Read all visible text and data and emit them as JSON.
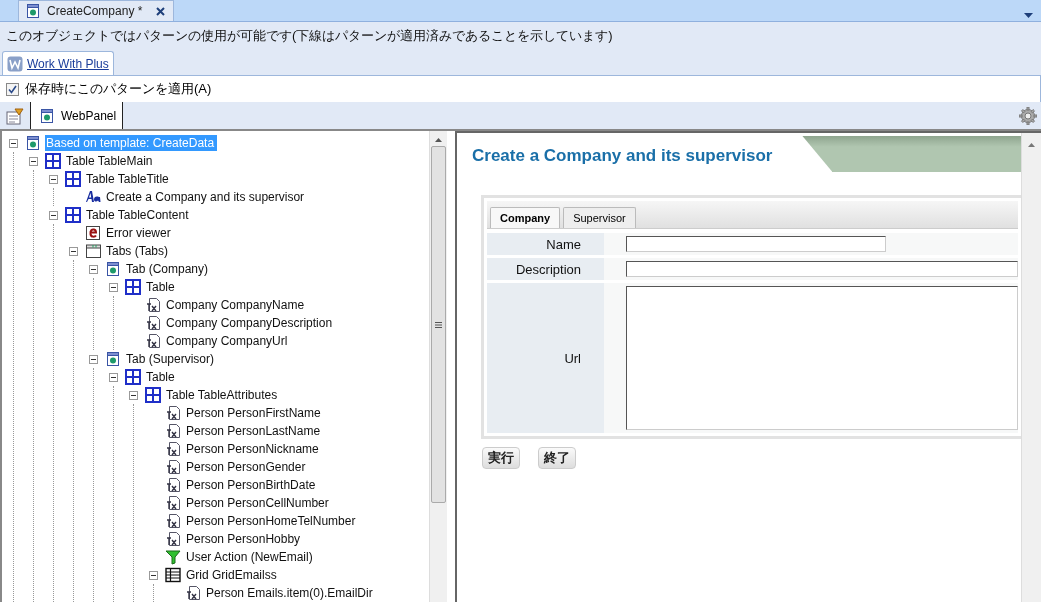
{
  "document_tab": {
    "title": "CreateCompany *",
    "selected": true
  },
  "info_text": "このオブジェクトではパターンの使用が可能です(下線はパターンが適用済みであることを示しています)",
  "pattern_tab": {
    "label": "Work With Plus",
    "selected": true
  },
  "apply_on_save": {
    "label": "保存時にこのパターンを適用(A)",
    "checked": true
  },
  "toolbar": {
    "tabs": [
      {
        "label": "WebPanel",
        "selected": true
      }
    ]
  },
  "tree": [
    {
      "label": "Based on template: CreateData",
      "kind": "form",
      "selected": true,
      "expanded": true,
      "children": [
        {
          "label": "Table TableMain",
          "kind": "table",
          "selected": false,
          "expanded": true,
          "children": [
            {
              "label": "Table TableTitle",
              "kind": "table",
              "selected": false,
              "expanded": true,
              "children": [
                {
                  "label": "Create a Company and its supervisor",
                  "kind": "text",
                  "selected": false
                }
              ]
            },
            {
              "label": "Table TableContent",
              "kind": "table",
              "selected": false,
              "expanded": true,
              "children": [
                {
                  "label": "Error viewer",
                  "kind": "error",
                  "selected": false
                },
                {
                  "label": "Tabs (Tabs)",
                  "kind": "tabs",
                  "selected": false,
                  "expanded": true,
                  "children": [
                    {
                      "label": "Tab (Company)",
                      "kind": "form",
                      "selected": false,
                      "expanded": true,
                      "children": [
                        {
                          "label": "Table",
                          "kind": "table",
                          "selected": false,
                          "expanded": true,
                          "children": [
                            {
                              "label": "Company CompanyName",
                              "kind": "attribute",
                              "selected": false
                            },
                            {
                              "label": "Company CompanyDescription",
                              "kind": "attribute",
                              "selected": false
                            },
                            {
                              "label": "Company CompanyUrl",
                              "kind": "attribute",
                              "selected": false
                            }
                          ]
                        }
                      ]
                    },
                    {
                      "label": "Tab (Supervisor)",
                      "kind": "form",
                      "selected": false,
                      "expanded": true,
                      "children": [
                        {
                          "label": "Table",
                          "kind": "table",
                          "selected": false,
                          "expanded": true,
                          "children": [
                            {
                              "label": "Table TableAttributes",
                              "kind": "table",
                              "selected": false,
                              "expanded": true,
                              "children": [
                                {
                                  "label": "Person PersonFirstName",
                                  "kind": "attribute",
                                  "selected": false
                                },
                                {
                                  "label": "Person PersonLastName",
                                  "kind": "attribute",
                                  "selected": false
                                },
                                {
                                  "label": "Person PersonNickname",
                                  "kind": "attribute",
                                  "selected": false
                                },
                                {
                                  "label": "Person PersonGender",
                                  "kind": "attribute",
                                  "selected": false
                                },
                                {
                                  "label": "Person PersonBirthDate",
                                  "kind": "attribute",
                                  "selected": false
                                },
                                {
                                  "label": "Person PersonCellNumber",
                                  "kind": "attribute",
                                  "selected": false
                                },
                                {
                                  "label": "Person PersonHomeTelNumber",
                                  "kind": "attribute",
                                  "selected": false
                                },
                                {
                                  "label": "Person PersonHobby",
                                  "kind": "attribute",
                                  "selected": false
                                },
                                {
                                  "label": "User Action (NewEmail)",
                                  "kind": "action",
                                  "selected": false
                                },
                                {
                                  "label": "Grid GridEmailss",
                                  "kind": "grid",
                                  "selected": false,
                                  "expanded": true,
                                  "children": [
                                    {
                                      "label": "Person Emails.item(0).EmailDir",
                                      "kind": "attribute",
                                      "selected": false
                                    }
                                  ]
                                }
                              ]
                            }
                          ]
                        }
                      ]
                    }
                  ]
                }
              ]
            }
          ]
        }
      ]
    }
  ],
  "preview": {
    "title": "Create a Company and its supervisor",
    "tabs": [
      {
        "label": "Company",
        "selected": true
      },
      {
        "label": "Supervisor",
        "selected": false
      }
    ],
    "fields": [
      {
        "label": "Name",
        "kind": "short"
      },
      {
        "label": "Description",
        "kind": "wide"
      },
      {
        "label": "Url",
        "kind": "multiline"
      }
    ],
    "buttons": [
      "実行",
      "終了"
    ]
  }
}
